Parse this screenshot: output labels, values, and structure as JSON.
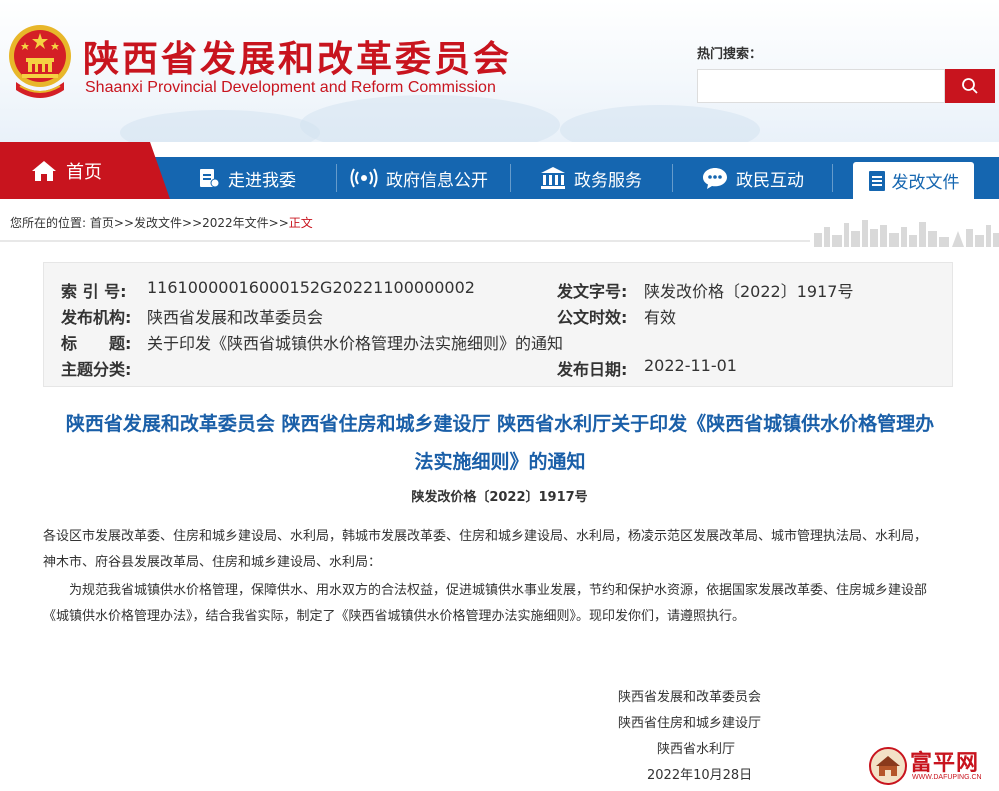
{
  "header": {
    "site_name": "陕西省发展和改革委员会",
    "site_name_en": "Shaanxi Provincial Development and Reform Commission",
    "hot_search_label": "热门搜索：",
    "search_placeholder": ""
  },
  "nav": {
    "home": "首页",
    "items": [
      "走进我委",
      "政府信息公开",
      "政务服务",
      "政民互动"
    ],
    "active": "发改文件"
  },
  "breadcrumb": {
    "prefix": "您所在的位置:",
    "home": "首页",
    "sep": ">>",
    "level1": "发改文件",
    "level2": "2022年文件",
    "current": "正文"
  },
  "meta": {
    "index_key": "索 引 号:",
    "index_val": "11610000016000152G20221100000002",
    "docno_key": "发文字号:",
    "docno_val": "陕发改价格〔2022〕1917号",
    "org_key": "发布机构:",
    "org_val": "陕西省发展和改革委员会",
    "valid_key": "公文时效:",
    "valid_val": "有效",
    "title_key": "标　　题:",
    "title_val": "关于印发《陕西省城镇供水价格管理办法实施细则》的通知",
    "topic_key": "主题分类:",
    "topic_val": "",
    "date_key": "发布日期:",
    "date_val": "2022-11-01"
  },
  "article": {
    "title_line1": "陕西省发展和改革委员会 陕西省住房和城乡建设厅 陕西省水利厅关于印发《陕西省城镇供水价格管理办",
    "title_line2": "法实施细则》的通知",
    "doc_no": "陕发改价格〔2022〕1917号",
    "recipients_line1": "各设区市发展改革委、住房和城乡建设局、水利局，韩城市发展改革委、住房和城乡建设局、水利局，杨凌示范区发展改革局、城市管理执法局、水利局，",
    "recipients_line2": "神木市、府谷县发展改革局、住房和城乡建设局、水利局：",
    "para_line1": "为规范我省城镇供水价格管理，保障供水、用水双方的合法权益，促进城镇供水事业发展，节约和保护水资源，依据国家发展改革委、住房城乡建设部",
    "para_line2": "《城镇供水价格管理办法》，结合我省实际，制定了《陕西省城镇供水价格管理办法实施细则》。现印发你们，请遵照执行。",
    "sign1": "陕西省发展和改革委员会",
    "sign2": "陕西省住房和城乡建设厅",
    "sign3": "陕西省水利厅",
    "sign_date": "2022年10月28日"
  },
  "watermark": {
    "text": "富平网",
    "domain": "WWW.DAFUPING.CN"
  },
  "colors": {
    "brand_red": "#c8141e",
    "nav_blue": "#1566b0",
    "title_blue": "#1a5fa8"
  }
}
